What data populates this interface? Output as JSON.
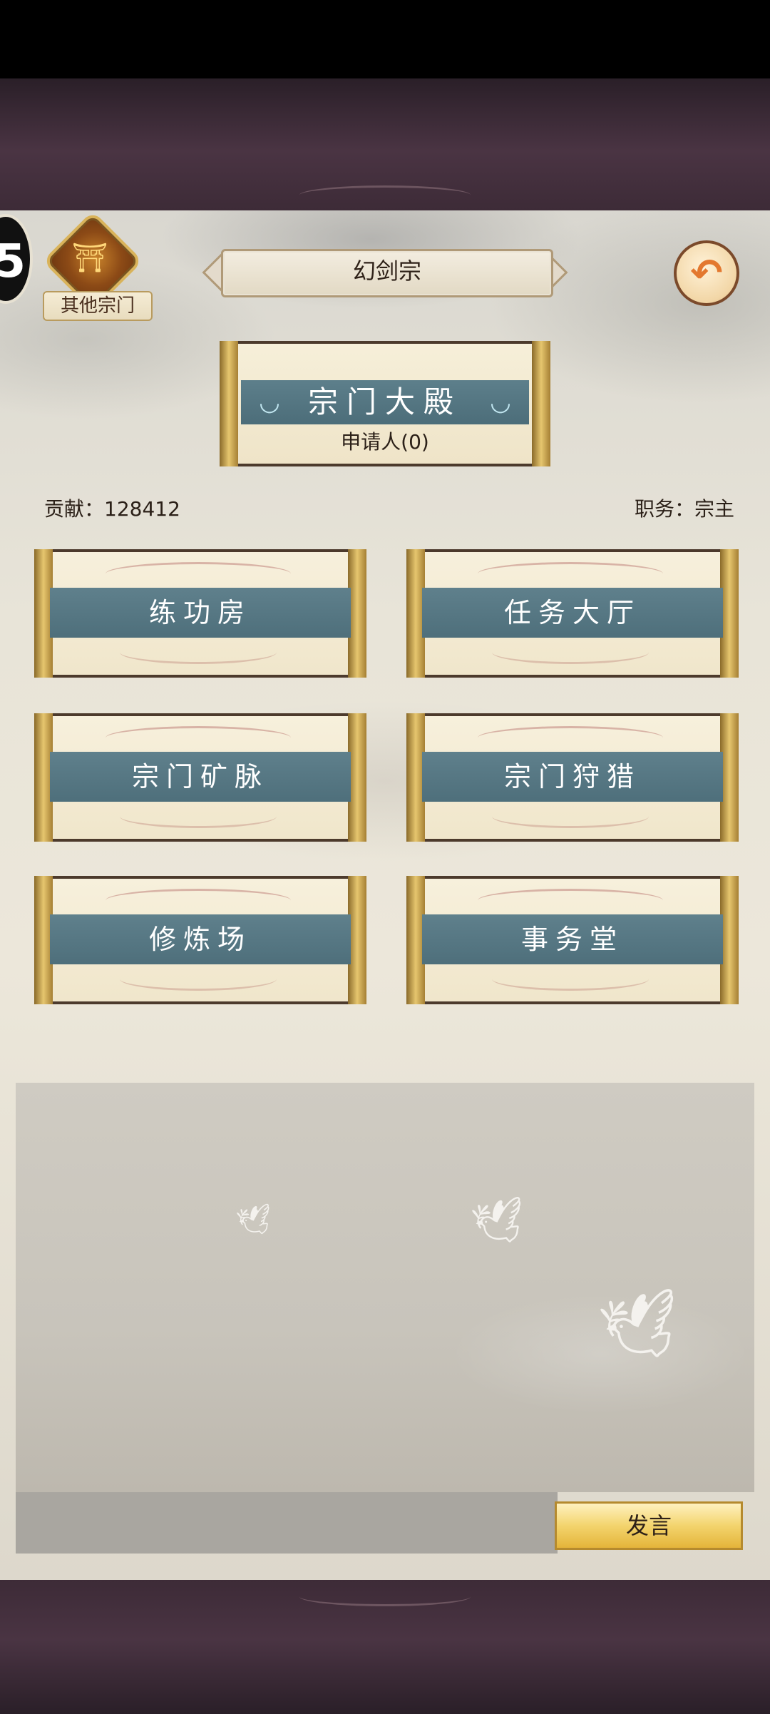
{
  "header": {
    "level_badge": "5",
    "other_sect_label": "其他宗门",
    "sect_name": "幻剑宗"
  },
  "hall": {
    "title": "宗门大殿",
    "applicants": "申请人(0)"
  },
  "info": {
    "contribution": "贡献：128412",
    "position": "职务：宗主"
  },
  "cards": [
    {
      "label": "练功房"
    },
    {
      "label": "任务大厅"
    },
    {
      "label": "宗门矿脉"
    },
    {
      "label": "宗门狩猎"
    },
    {
      "label": "修炼场"
    },
    {
      "label": "事务堂"
    }
  ],
  "chat": {
    "input_value": "",
    "send_label": "发言"
  },
  "colors": {
    "band_blue": "#4e6f7b",
    "gold": "#e6c66e",
    "frame_dark": "#4c3a2c"
  }
}
